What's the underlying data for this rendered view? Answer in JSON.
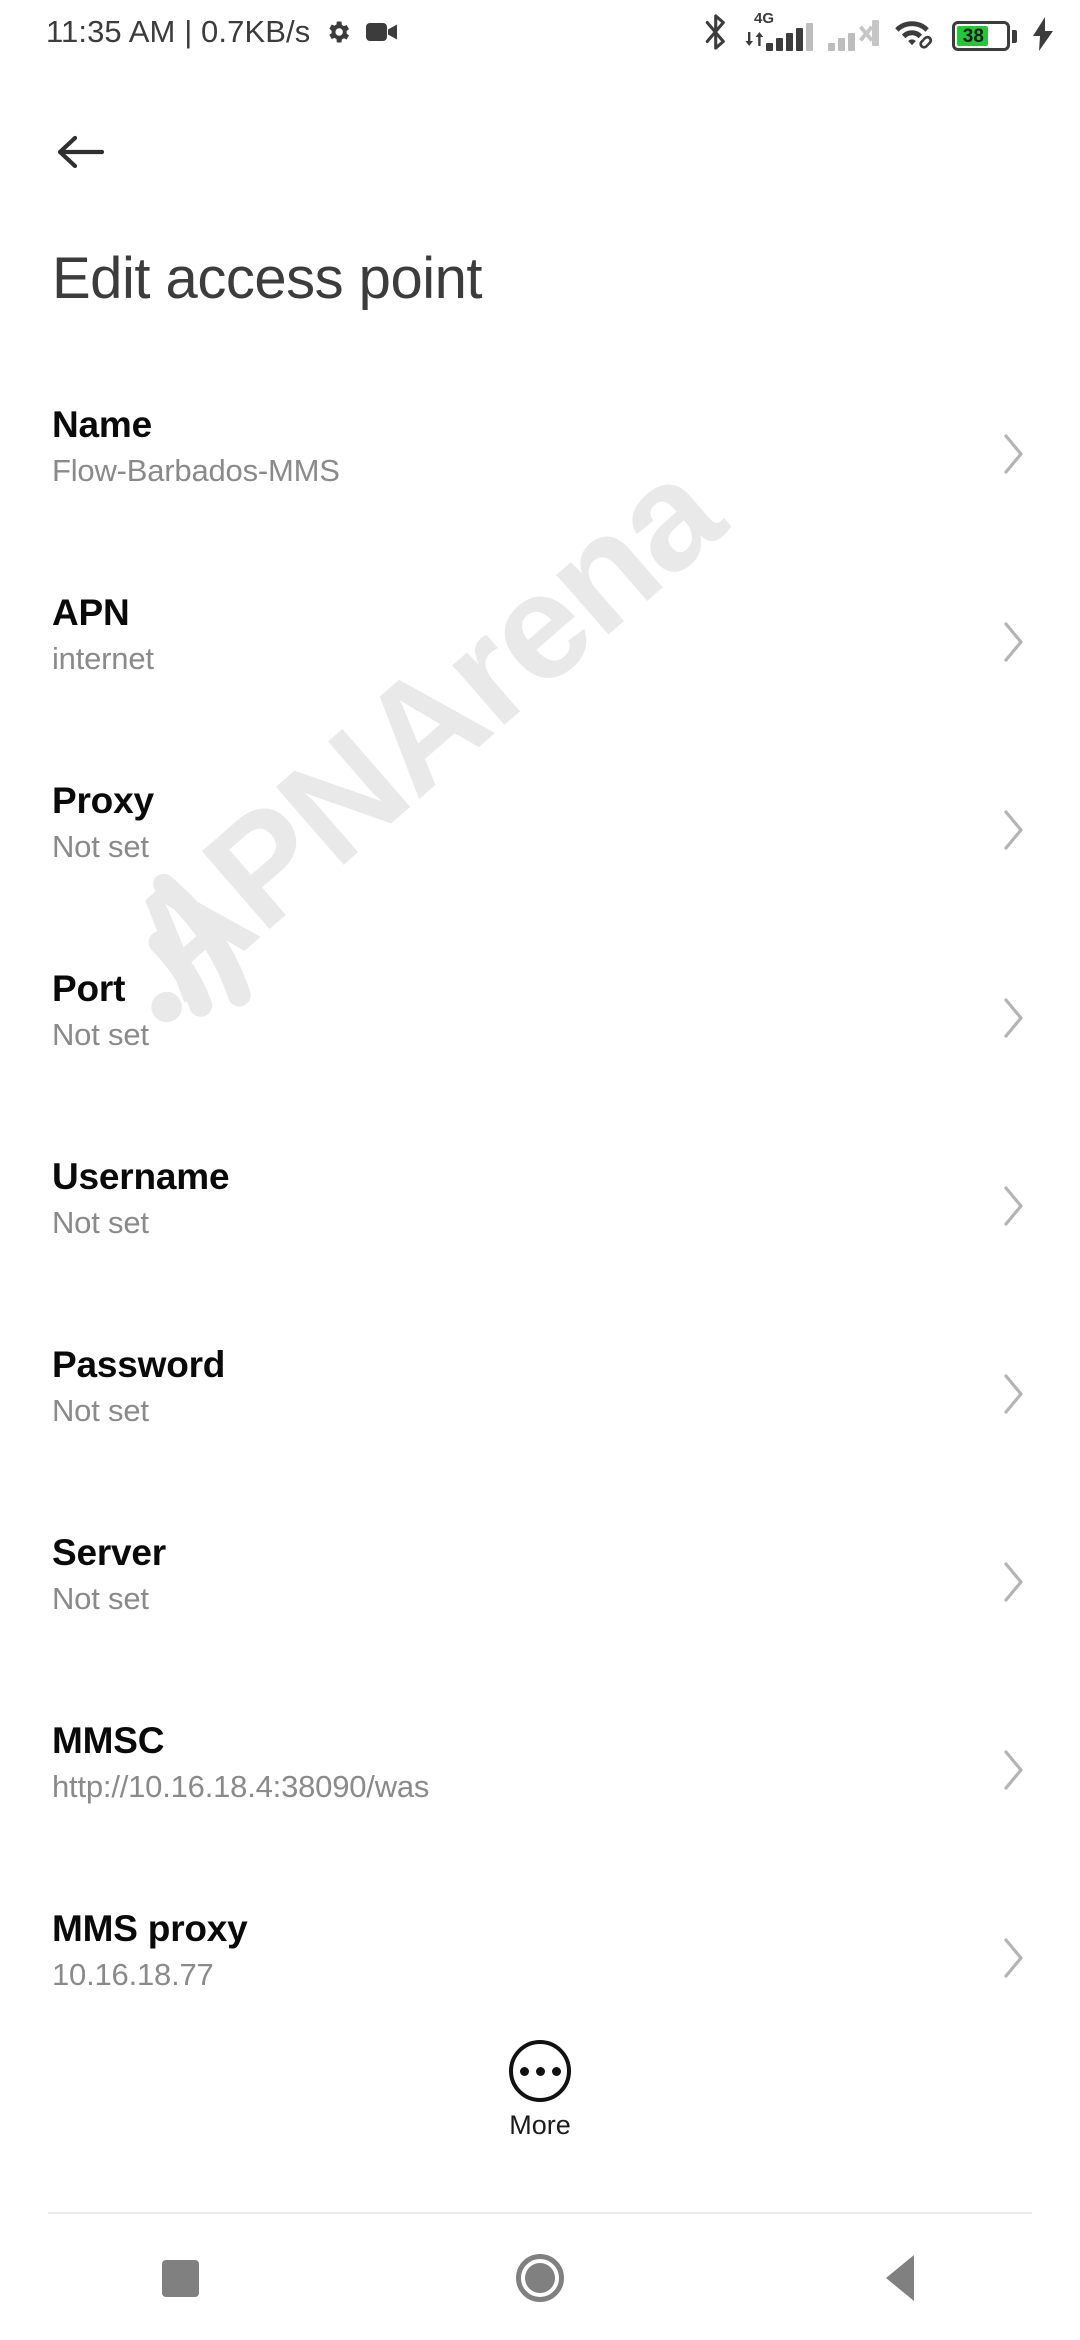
{
  "statusbar": {
    "clock": "11:35 AM | 0.7KB/s",
    "icons_left": [
      "gear-icon",
      "camcorder-icon"
    ],
    "bluetooth": "bluetooth-icon",
    "network_label": "4G",
    "sim1": "signal-bars-icon",
    "sim2": "signal-bars-no-service-icon",
    "wifi": "wifi-linked-icon",
    "battery_percent": "38",
    "battery_color": "#25c63a",
    "charging": "charging-bolt-icon"
  },
  "header": {
    "back_icon": "arrow-left-icon",
    "title": "Edit access point"
  },
  "watermark": {
    "text": "APNArena",
    "color": "#e9e9e9"
  },
  "settings": {
    "rows": [
      {
        "label": "Name",
        "value": "Flow-Barbados-MMS"
      },
      {
        "label": "APN",
        "value": "internet"
      },
      {
        "label": "Proxy",
        "value": "Not set"
      },
      {
        "label": "Port",
        "value": "Not set"
      },
      {
        "label": "Username",
        "value": "Not set"
      },
      {
        "label": "Password",
        "value": "Not set"
      },
      {
        "label": "Server",
        "value": "Not set"
      },
      {
        "label": "MMSC",
        "value": "http://10.16.18.4:38090/was"
      },
      {
        "label": "MMS proxy",
        "value": "10.16.18.77"
      }
    ]
  },
  "more": {
    "label": "More",
    "icon": "ellipsis-circle-icon"
  },
  "navbar": {
    "recents": "square-icon",
    "home": "circle-icon",
    "back": "triangle-left-icon"
  }
}
